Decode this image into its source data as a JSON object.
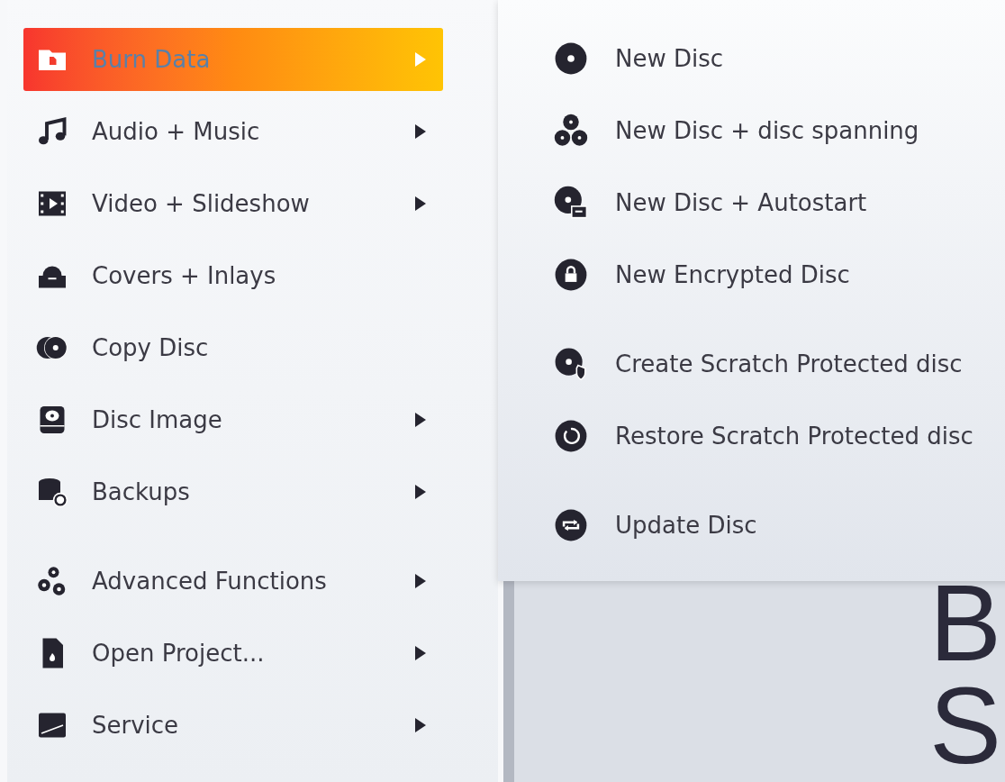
{
  "main_menu": {
    "groups": [
      [
        {
          "label": "Burn Data",
          "selected": true,
          "submenu": true
        },
        {
          "label": "Audio + Music",
          "selected": false,
          "submenu": true
        },
        {
          "label": "Video + Slideshow",
          "selected": false,
          "submenu": true
        },
        {
          "label": "Covers + Inlays",
          "selected": false,
          "submenu": false
        },
        {
          "label": "Copy Disc",
          "selected": false,
          "submenu": false
        },
        {
          "label": "Disc Image",
          "selected": false,
          "submenu": true
        },
        {
          "label": "Backups",
          "selected": false,
          "submenu": true
        }
      ],
      [
        {
          "label": "Advanced Functions",
          "selected": false,
          "submenu": true
        },
        {
          "label": "Open Project...",
          "selected": false,
          "submenu": true
        },
        {
          "label": "Service",
          "selected": false,
          "submenu": true
        }
      ]
    ]
  },
  "submenu": {
    "groups": [
      [
        {
          "label": "New Disc"
        },
        {
          "label": "New Disc + disc spanning"
        },
        {
          "label": "New Disc + Autostart"
        },
        {
          "label": "New Encrypted Disc"
        }
      ],
      [
        {
          "label": "Create Scratch Protected disc"
        },
        {
          "label": "Restore Scratch Protected disc"
        }
      ],
      [
        {
          "label": "Update Disc"
        }
      ]
    ]
  },
  "background_title": [
    "B",
    "S"
  ]
}
